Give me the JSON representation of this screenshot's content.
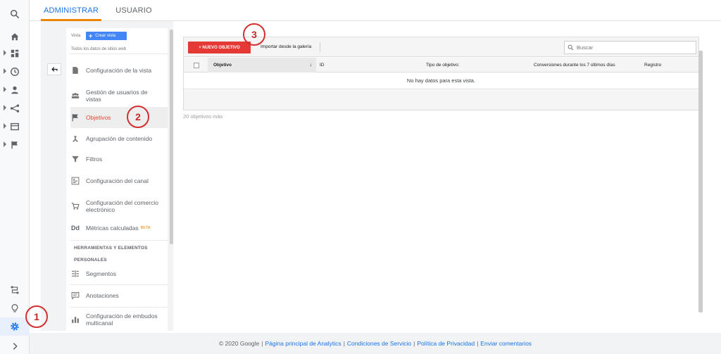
{
  "tabs": {
    "admin": "ADMINISTRAR",
    "user": "USUARIO"
  },
  "view": {
    "label": "Vista",
    "create_button": "Crear vista",
    "all_data": "Todos los datos de sitios web"
  },
  "menu": {
    "view_settings": "Configuración de la vista",
    "user_management": "Gestión de usuarios de vistas",
    "goals": "Objetivos",
    "content_grouping": "Agrupación de contenido",
    "filters": "Filtros",
    "channel_settings": "Configuración del canal",
    "ecommerce_settings": "Configuración del comercio electrónico",
    "calculated_metrics": "Métricas calculadas",
    "calculated_metrics_badge": "BETA",
    "section_tools_line1": "HERRAMIENTAS Y ELEMENTOS",
    "section_tools_line2": "PERSONALES",
    "segments": "Segmentos",
    "annotations": "Anotaciones",
    "multichannel_funnels": "Configuración de embudos multicanal"
  },
  "toolbar": {
    "new_goal": "+ NUEVO OBJETIVO",
    "import_gallery": "Importar desde la galería",
    "search_placeholder": "Buscar"
  },
  "table": {
    "columns": [
      "Objetivo",
      "ID",
      "Tipo de objetivo:",
      "Conversiones durante los 7 últimos días",
      "Registro"
    ],
    "empty_message": "No hay datos para esta vista."
  },
  "more_goals": "20 objetivos más",
  "annotations": [
    "1",
    "2",
    "3"
  ],
  "footer": {
    "copyright": "© 2020 Google",
    "links": [
      "Página principal de Analytics",
      "Condiciones de Servicio",
      "Política de Privacidad",
      "Enviar comentarios"
    ]
  },
  "rail_icons": [
    "search-icon",
    "home-icon",
    "customization-icon",
    "realtime-icon",
    "audience-icon",
    "acquisition-icon",
    "behavior-icon",
    "conversions-icon",
    "attribution-icon",
    "discover-icon",
    "admin-gear-icon",
    "expand-icon"
  ],
  "colors": {
    "accent": "#1a73e8",
    "new_goal": "#e53935",
    "tab_underline": "#ea8600",
    "annotation": "#d32f2f"
  }
}
